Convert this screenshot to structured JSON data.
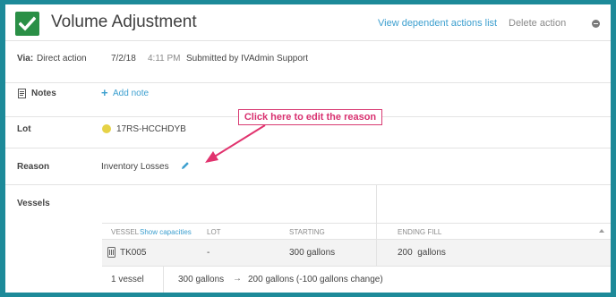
{
  "header": {
    "title": "Volume Adjustment",
    "status_icon": "check-icon",
    "view_dependent_label": "View dependent actions list",
    "delete_label": "Delete action",
    "delete_icon": "minus-circle-icon"
  },
  "via": {
    "label": "Via:",
    "value": "Direct action",
    "date": "7/2/18",
    "time": "4:11 PM",
    "submitted": "Submitted by IVAdmin Support"
  },
  "notes": {
    "label": "Notes",
    "icon": "notes-icon",
    "add_label": "Add note"
  },
  "lot": {
    "label": "Lot",
    "value": "17RS-HCCHDYB",
    "dot_color": "#e6d246"
  },
  "reason": {
    "label": "Reason",
    "value": "Inventory Losses",
    "edit_icon": "pencil-icon"
  },
  "callout": {
    "text": "Click here to edit the reason"
  },
  "vessels": {
    "label": "Vessels",
    "columns": {
      "vessel": "VESSEL",
      "show_capacities": "Show capacities",
      "lot": "LOT",
      "starting": "STARTING",
      "ending": "ENDING FILL"
    },
    "rows": [
      {
        "vessel": "TK005",
        "lot": "-",
        "starting": "300 gallons",
        "ending": "200  gallons"
      }
    ],
    "footer": {
      "count": "1 vessel",
      "from": "300 gallons",
      "arrow": "→",
      "to": "200 gallons (-100 gallons change)"
    }
  },
  "colors": {
    "background": "#1d8a99",
    "check_green": "#2a8f46",
    "link_blue": "#3c9fcf",
    "callout_pink": "#d8306f"
  }
}
